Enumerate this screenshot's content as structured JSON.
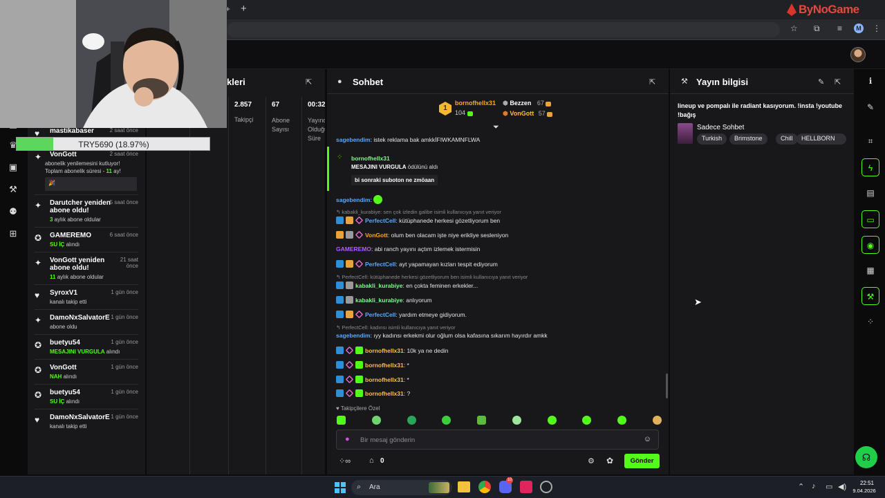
{
  "browser": {
    "new_tab": "+",
    "close_tab": "×",
    "watermark": "ByNoGame",
    "profile_initial": "M"
  },
  "activity": {
    "items": [
      {
        "name": "mastikabaser",
        "time": "2 saat önce",
        "sub_prefix": "",
        "sub_highlight": "",
        "sub_suffix": "",
        "icon": "heart-icon"
      },
      {
        "name": "VonGott",
        "time": "2 saat önce",
        "sub_prefix": "abonelik yenilemesini kutluyor!",
        "sub_line2_prefix": "Toplam abonelik süresi - ",
        "sub_line2_highlight": "11",
        "sub_line2_suffix": " ay!",
        "icon": "star-icon"
      },
      {
        "name": "Darutcher yeniden abone oldu!",
        "time": "5 saat önce",
        "sub_highlight": "3",
        "sub_suffix": " aylık abone oldular",
        "icon": "star-icon"
      },
      {
        "name": "GAMEREMO",
        "time": "6 saat önce",
        "sub_highlight": "SU İÇ",
        "sub_suffix": " alındı",
        "icon": "redeem-icon"
      },
      {
        "name": "VonGott yeniden abone oldu!",
        "time": "21 saat önce",
        "sub_highlight": "11",
        "sub_suffix": " aylık abone oldular",
        "icon": "star-icon"
      },
      {
        "name": "SyroxV1",
        "time": "1 gün önce",
        "sub_highlight": "",
        "sub_suffix": "kanalı takip etti",
        "icon": "heart-icon"
      },
      {
        "name": "DamoNxSalvatorE",
        "time": "1 gün önce",
        "sub_highlight": "",
        "sub_suffix": "abone oldu",
        "icon": "star-icon"
      },
      {
        "name": "buetyu54",
        "time": "1 gün önce",
        "sub_highlight": "MESAJINI VURGULA",
        "sub_suffix": " alındı",
        "icon": "redeem-icon"
      },
      {
        "name": "VonGott",
        "time": "1 gün önce",
        "sub_highlight": "NAH",
        "sub_suffix": " alındı",
        "icon": "redeem-icon"
      },
      {
        "name": "buetyu54",
        "time": "1 gün önce",
        "sub_highlight": "SU İÇ",
        "sub_suffix": " alındı",
        "icon": "redeem-icon"
      },
      {
        "name": "DamoNxSalvatorE",
        "time": "1 gün önce",
        "sub_highlight": "",
        "sub_suffix": "kanalı takip etti",
        "icon": "heart-icon"
      }
    ]
  },
  "subgoal": {
    "label": "TRY5690 (18.97%)",
    "progress": 0.1897
  },
  "stats": {
    "title": "kleri",
    "columns": [
      {
        "value": "2.857",
        "label": "Takipçi"
      },
      {
        "value": "67",
        "label": "Abone Sayısı"
      },
      {
        "value": "00:32",
        "label": "Yayında Olduğu Süre"
      }
    ]
  },
  "chat": {
    "title": "Sohbet",
    "leaderboard": {
      "first_name": "bornofhellx31",
      "first_count": "104",
      "second_name": "Bezzen",
      "second_count": "67",
      "third_name": "VonGott",
      "third_count": "57",
      "rank": "1"
    },
    "messages": {
      "m1_user": "sagebendim",
      "m1_text": ": istek reklama bak amkkİFIWKAMNFLWA",
      "redeem_user": "bornofhellx31",
      "redeem_action": "MESAJINI VURGULA",
      "redeem_suffix": " ödülünü aldı",
      "redeem_msg": "bi sonraki suboton ne zmöaan",
      "m2_user": "sagebendim",
      "m2_text": ":",
      "r1": "kabakli_kurabiye: sen çok izledin galibe isimli kullanıcıya yanıt veriyor",
      "m3_user": "PerfectCell",
      "m3_text": ": kütüphanede herkesi gözetliyorum ben",
      "m4_user": "VonGott",
      "m4_text": ": olum ben olacam işte niye erikliye sesleniyon",
      "m5_user": "GAMEREMO",
      "m5_text": ": abi ranch yayını açtım izlemek istermisin",
      "m6_user": "PerfectCell",
      "m6_text": ": ayt yapamayan kızları tespit ediyorum",
      "r2": "PerfectCell: kütüphanede herkesi gözetliyorum ben isimli kullanıcıya yanıt veriyor",
      "m7_user": "kabakli_kurabiye",
      "m7_text": ": en çokta feminen erkekler...",
      "m8_user": "kabakli_kurabiye",
      "m8_text": ": anlıyorum",
      "m9_user": "PerfectCell",
      "m9_text": ": yardım etmeye gidiyorum.",
      "r3": "PerfectCell: kadınsı isimli kullanıcıya yanıt veriyor",
      "m10_user": "sagebendim",
      "m10_text": ": ıyy kadınsı erkekmi olur oğlum olsa kafasına sıkarım hayırdır amkk",
      "m11_user": "bornofhellx31",
      "m11_text": ": 10k ya ne dedin",
      "m12_user": "bornofhellx31",
      "m12_text": ": *",
      "m13_user": "bornofhellx31",
      "m13_text": ": *",
      "m14_user": "bornofhellx31",
      "m14_text": ": ?"
    },
    "emote_label": "Takipçilere Özel",
    "input_placeholder": "Bir mesaj gönderin",
    "points": "0",
    "send_label": "Gönder"
  },
  "info": {
    "title": "Yayın bilgisi",
    "description": "lineup ve pompalı ile radiant kasıyorum. !insta !youtube !bağış",
    "category": "Sadece Sohbet",
    "tags": [
      "Turkish",
      "Brimstone",
      "Chill",
      "HELLBORN"
    ]
  },
  "taskbar": {
    "search": "Ara",
    "time": "22:51",
    "date": "9.04.2026",
    "discord_badge": "10"
  },
  "colors": {
    "accent": "#53fc18",
    "panel": "#18181b",
    "background": "#0b0b0c"
  }
}
